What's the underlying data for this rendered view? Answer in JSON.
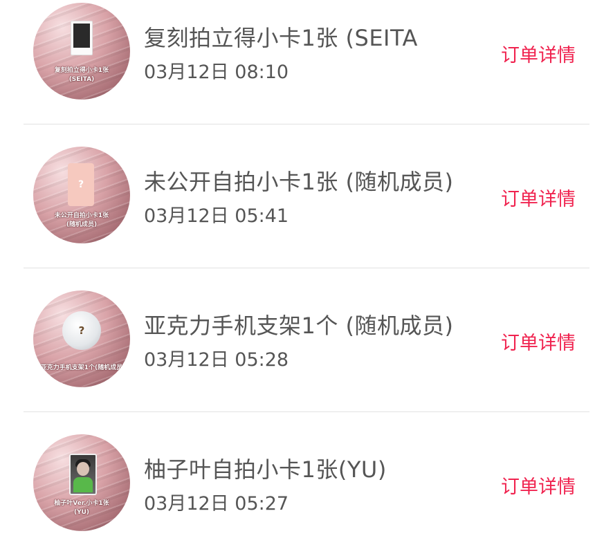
{
  "orders": [
    {
      "title": "复刻拍立得小卡1张 (SEITA",
      "time": "03月12日 08:10",
      "detail_label": "订单详情",
      "thumb_caption_line1": "复刻拍立得小卡1张",
      "thumb_caption_line2": "(SEITA)"
    },
    {
      "title": "未公开自拍小卡1张 (随机成员)",
      "time": "03月12日 05:41",
      "detail_label": "订单详情",
      "thumb_mark": "?",
      "thumb_caption_line1": "未公开自拍小卡1张",
      "thumb_caption_line2": "(随机成员)"
    },
    {
      "title": "亚克力手机支架1个 (随机成员)",
      "time": "03月12日 05:28",
      "detail_label": "订单详情",
      "thumb_mark": "?",
      "thumb_caption_line1": "亚克力手机支架1个(随机成员"
    },
    {
      "title": "柚子叶自拍小卡1张(YU)",
      "time": "03月12日 05:27",
      "detail_label": "订单详情",
      "thumb_caption_line1": "柚子叶Ver.小卡1张",
      "thumb_caption_line2": "(YU)"
    }
  ],
  "colors": {
    "accent": "#f0234f",
    "text": "#555555",
    "divider": "#e2e2e2"
  }
}
